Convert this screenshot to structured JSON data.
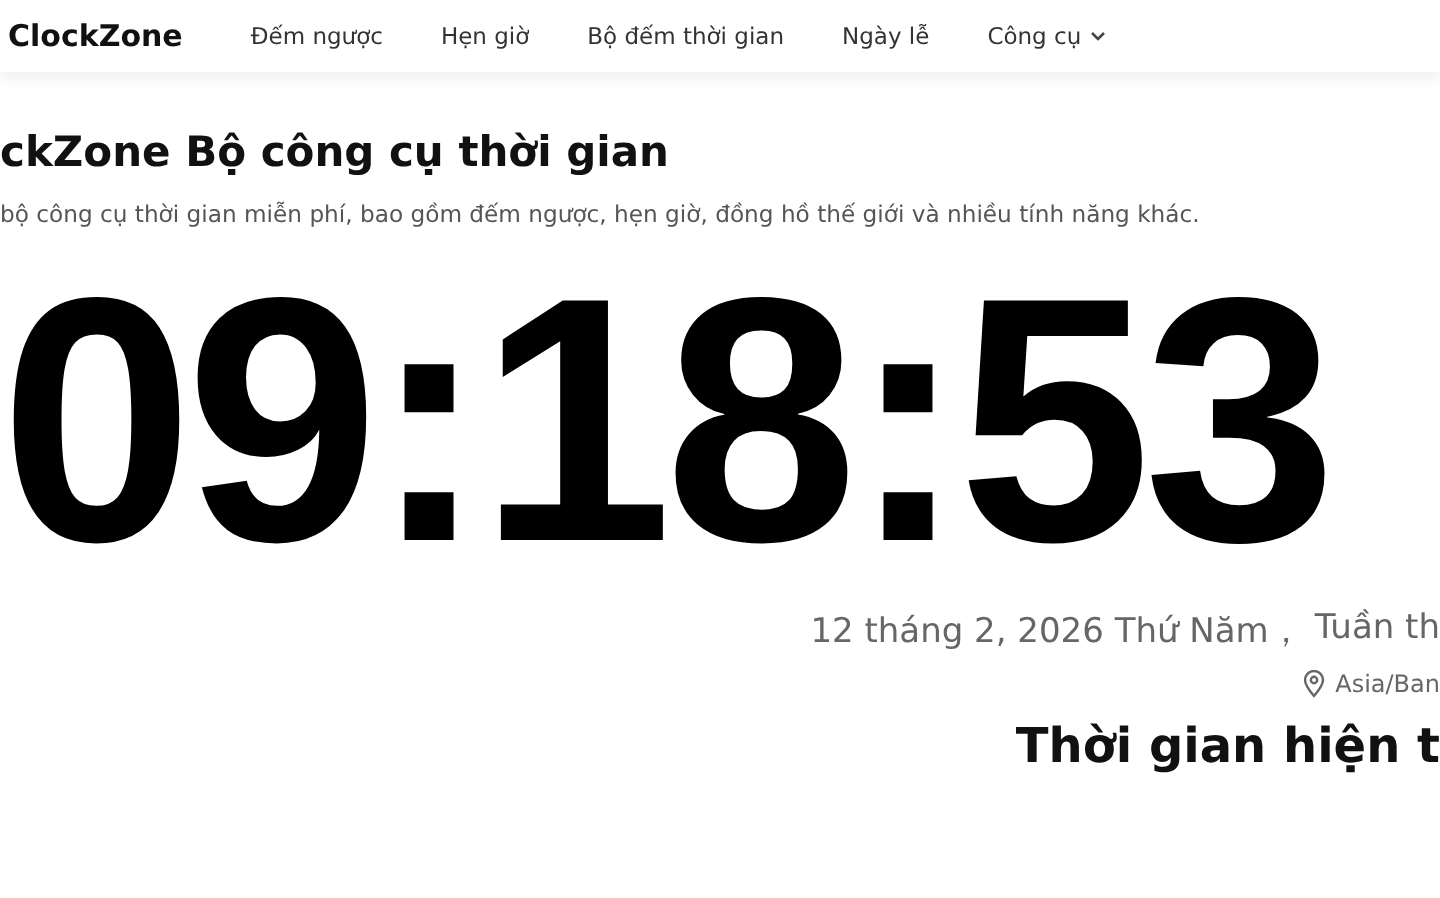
{
  "header": {
    "logo": "ClockZone",
    "nav": [
      {
        "label": "Đếm ngược",
        "kind": "link"
      },
      {
        "label": "Hẹn giờ",
        "kind": "link"
      },
      {
        "label": "Bộ đếm thời gian",
        "kind": "link"
      },
      {
        "label": "Ngày lễ",
        "kind": "link"
      },
      {
        "label": "Công cụ",
        "kind": "dropdown"
      }
    ]
  },
  "hero": {
    "title": "ckZone Bộ công cụ thời gian",
    "subtitle": "bộ công cụ thời gian miễn phí, bao gồm đếm ngược, hẹn giờ, đồng hồ thế giới và nhiều tính năng khác."
  },
  "clock": {
    "time": "09:18:53",
    "date": "12 tháng 2, 2026 Thứ Năm，",
    "week": "Tuần th",
    "timezone": "Asia/Ban"
  },
  "section_title": "Thời gian hiện t"
}
